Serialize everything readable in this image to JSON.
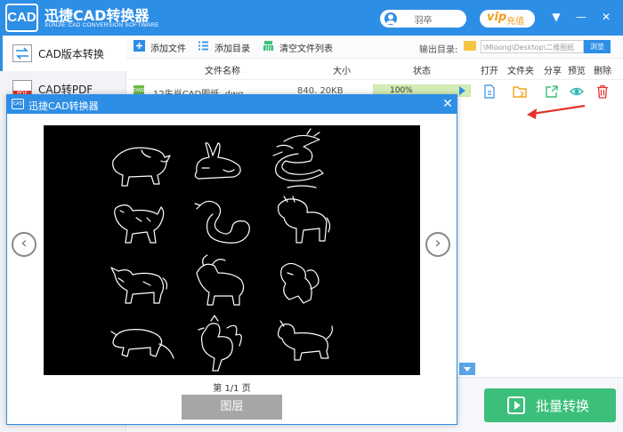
{
  "app": {
    "logo_text": "CAD",
    "title": "迅捷CAD转换器",
    "subtitle": "XUNJIE CAD CONVERSION SOFTWARE",
    "user_name": "羽卒",
    "vip_logo": "vip",
    "vip_label": "充值",
    "controls": [
      "▼",
      "—",
      "✕"
    ]
  },
  "sidebar": {
    "items": [
      {
        "label": "CAD版本转换",
        "icon": "cad-version-icon",
        "active": true
      },
      {
        "label": "CAD转PDF",
        "icon": "pdf-icon",
        "active": false
      }
    ]
  },
  "toolbar": {
    "add_file": "添加文件",
    "add_folder": "添加目录",
    "clear_list": "清空文件列表",
    "output_label": "输出目录:",
    "output_path": "\\Mloong\\Desktop\\二维图纸",
    "browse": "浏览"
  },
  "table": {
    "headers": [
      "文件名称",
      "大小",
      "状态",
      "打开",
      "文件夹",
      "分享",
      "预览",
      "删除"
    ],
    "rows": [
      {
        "type_badge": "DWG",
        "name": "12生肖CAD图纸 .dwg",
        "size": "840. 20KB",
        "status": "100%",
        "progress": 1.0
      }
    ]
  },
  "bottom": {
    "batch_convert": "批量转换"
  },
  "modal": {
    "logo_text": "CAD",
    "title": "迅捷CAD转换器",
    "close": "✕",
    "prev": "‹",
    "next": "›",
    "page_info": "第 1/1 页",
    "layer_button": "图层"
  },
  "colors": {
    "primary": "#2d8ee6",
    "green": "#3cbf7a",
    "vip": "#f29b1d",
    "delete": "#e5322d",
    "arrow": "#e5322d"
  }
}
